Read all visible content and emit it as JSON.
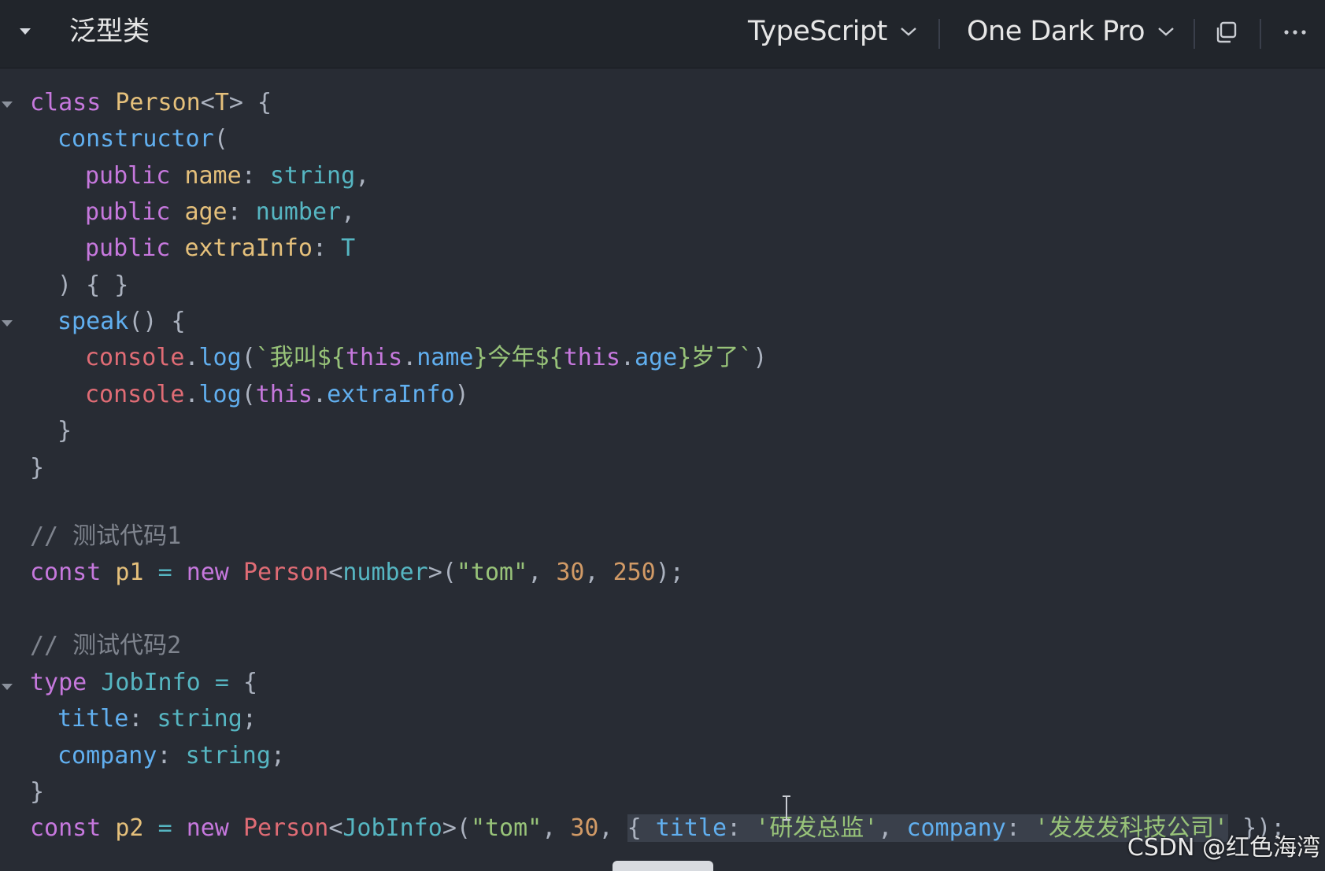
{
  "header": {
    "title": "泛型类",
    "language": "TypeScript",
    "theme": "One Dark Pro"
  },
  "code": {
    "l1": [
      "class",
      "Person",
      "<",
      "T",
      "> {"
    ],
    "l2": [
      "constructor",
      "("
    ],
    "l3": [
      "public",
      "name",
      ": ",
      "string",
      ","
    ],
    "l4": [
      "public",
      "age",
      ": ",
      "number",
      ","
    ],
    "l5": [
      "public",
      "extraInfo",
      ": ",
      "T"
    ],
    "l6": [
      ") { }"
    ],
    "l7": [
      "speak",
      "() {"
    ],
    "l8": [
      "console",
      ".",
      "log",
      "(",
      "`我叫${",
      "this",
      ".",
      "name",
      "}今年${",
      "this",
      ".",
      "age",
      "}岁了`",
      ")"
    ],
    "l9": [
      "console",
      ".",
      "log",
      "(",
      "this",
      ".",
      "extraInfo",
      ")"
    ],
    "l10": [
      "}"
    ],
    "l11": [
      "}"
    ],
    "l12": [
      "// 测试代码1"
    ],
    "l13": [
      "const",
      "p1",
      "=",
      "new",
      "Person",
      "<",
      "number",
      ">(",
      "\"tom\"",
      ", ",
      "30",
      ", ",
      "250",
      ");"
    ],
    "l14": [
      "// 测试代码2"
    ],
    "l15": [
      "type",
      "JobInfo",
      "=",
      "{"
    ],
    "l16": [
      "title",
      ": ",
      "string",
      ";"
    ],
    "l17": [
      "company",
      ": ",
      "string",
      ";"
    ],
    "l18": [
      "}"
    ],
    "l19": [
      "const",
      "p2",
      "=",
      "new",
      "Person",
      "<",
      "JobInfo",
      ">(",
      "\"tom\"",
      ", ",
      "30",
      ", ",
      "{ ",
      "title",
      ": ",
      "'研发总监'",
      ", ",
      "company",
      ": ",
      "'发发发科技公司'",
      " });"
    ]
  },
  "watermark": "CSDN @红色海湾",
  "colors": {
    "background": "#282c34",
    "keyword": "#c678dd",
    "class": "#e5c07b",
    "function": "#61afef",
    "type": "#56b6c2",
    "string": "#98c379",
    "number": "#d19a66",
    "object": "#e06c75",
    "comment": "#7f848e"
  }
}
